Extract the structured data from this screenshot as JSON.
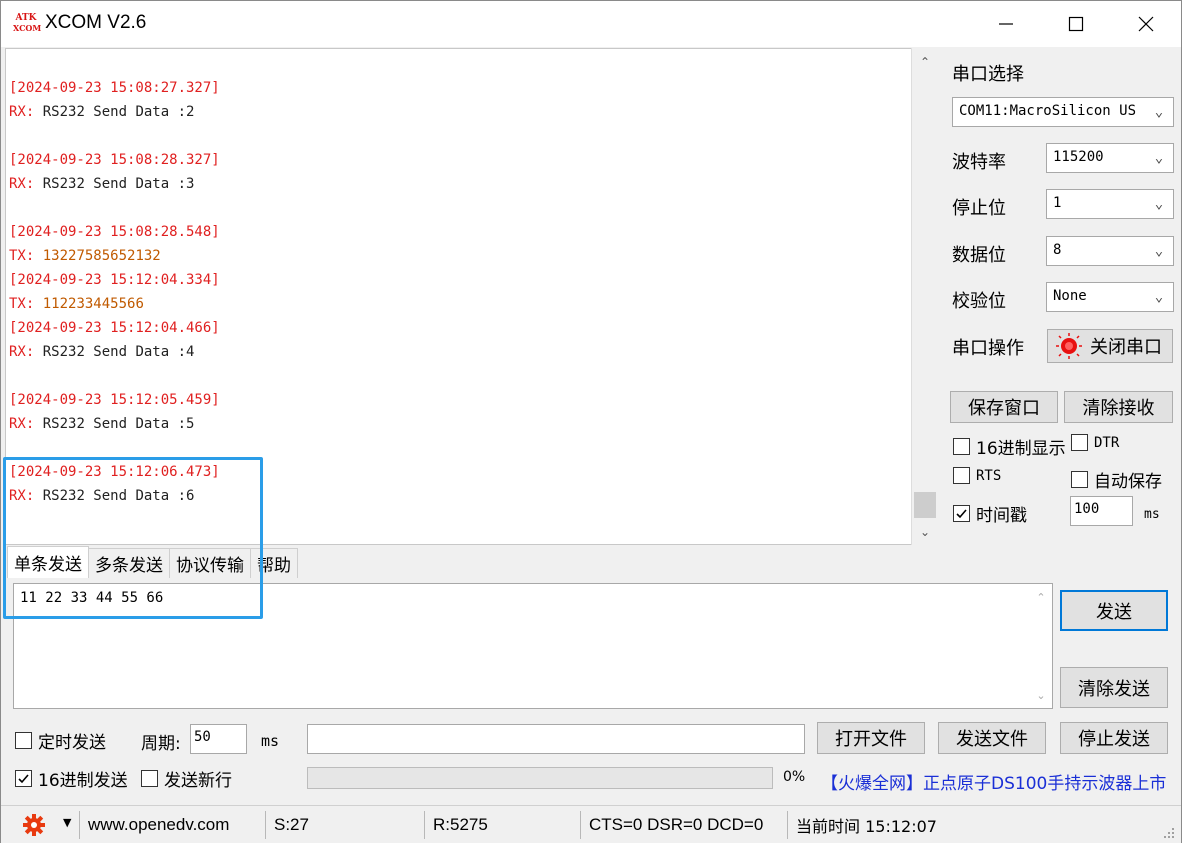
{
  "window": {
    "title": "XCOM V2.6",
    "logo_text_top": "ATK",
    "logo_text_bottom": "XCOM"
  },
  "receive": {
    "lines": [
      {
        "kind": "ts",
        "text": "[2024-09-23 15:08:27.327]"
      },
      {
        "kind": "rx",
        "prefix": "RX:",
        "text": " RS232 Send Data :2"
      },
      {
        "kind": "blank",
        "text": ""
      },
      {
        "kind": "ts",
        "text": "[2024-09-23 15:08:28.327]"
      },
      {
        "kind": "rx",
        "prefix": "RX:",
        "text": " RS232 Send Data :3"
      },
      {
        "kind": "blank",
        "text": ""
      },
      {
        "kind": "ts",
        "text": "[2024-09-23 15:08:28.548]"
      },
      {
        "kind": "tx",
        "prefix": "TX:",
        "text": " 13227585652132"
      },
      {
        "kind": "ts",
        "text": "[2024-09-23 15:12:04.334]"
      },
      {
        "kind": "tx",
        "prefix": "TX:",
        "text": " 112233445566"
      },
      {
        "kind": "ts",
        "text": "[2024-09-23 15:12:04.466]"
      },
      {
        "kind": "rx",
        "prefix": "RX:",
        "text": " RS232 Send Data :4"
      },
      {
        "kind": "blank",
        "text": ""
      },
      {
        "kind": "ts",
        "text": "[2024-09-23 15:12:05.459]"
      },
      {
        "kind": "rx",
        "prefix": "RX:",
        "text": " RS232 Send Data :5"
      },
      {
        "kind": "blank",
        "text": ""
      },
      {
        "kind": "ts",
        "text": "[2024-09-23 15:12:06.473]"
      },
      {
        "kind": "rx",
        "prefix": "RX:",
        "text": " RS232 Send Data :6"
      }
    ]
  },
  "settings": {
    "port_label": "串口选择",
    "port_value": "COM11:MacroSilicon US",
    "baud_label": "波特率",
    "baud_value": "115200",
    "stop_label": "停止位",
    "stop_value": "1",
    "data_label": "数据位",
    "data_value": "8",
    "parity_label": "校验位",
    "parity_value": "None",
    "op_label": "串口操作",
    "close_port_label": "关闭串口",
    "save_window_label": "保存窗口",
    "clear_recv_label": "清除接收",
    "hex_display_label": "16进制显示",
    "hex_display_checked": false,
    "dtr_label": "DTR",
    "dtr_checked": false,
    "rts_label": "RTS",
    "rts_checked": false,
    "autosave_label": "自动保存",
    "autosave_checked": false,
    "timestamp_label": "时间戳",
    "timestamp_checked": true,
    "timestamp_value": "100",
    "timestamp_unit": "ms"
  },
  "tabs": [
    {
      "label": "单条发送",
      "active": true
    },
    {
      "label": "多条发送",
      "active": false
    },
    {
      "label": "协议传输",
      "active": false
    },
    {
      "label": "帮助",
      "active": false
    }
  ],
  "send": {
    "text": "11 22 33 44 55 66",
    "send_label": "发送",
    "clear_send_label": "清除发送",
    "timed_send_label": "定时发送",
    "timed_send_checked": false,
    "period_label": "周期:",
    "period_value": "50",
    "period_unit": "ms",
    "file_path": "",
    "open_file_label": "打开文件",
    "send_file_label": "发送文件",
    "stop_send_label": "停止发送",
    "hex_send_label": "16进制发送",
    "hex_send_checked": true,
    "newline_label": "发送新行",
    "newline_checked": false,
    "progress_percent_label": "0%",
    "progress_fraction": 0,
    "ad_text": "【火爆全网】正点原子DS100手持示波器上市"
  },
  "status": {
    "website": "www.openedv.com",
    "sent": "S:27",
    "received": "R:5275",
    "signals": "CTS=0 DSR=0 DCD=0",
    "time_label": "当前时间 15:12:07"
  },
  "colors": {
    "timestamp": "#e02020",
    "tx_value": "#c05a00",
    "highlight": "#2a9de8",
    "ad_link": "#1a2fd6",
    "primary_border": "#0078d7"
  }
}
